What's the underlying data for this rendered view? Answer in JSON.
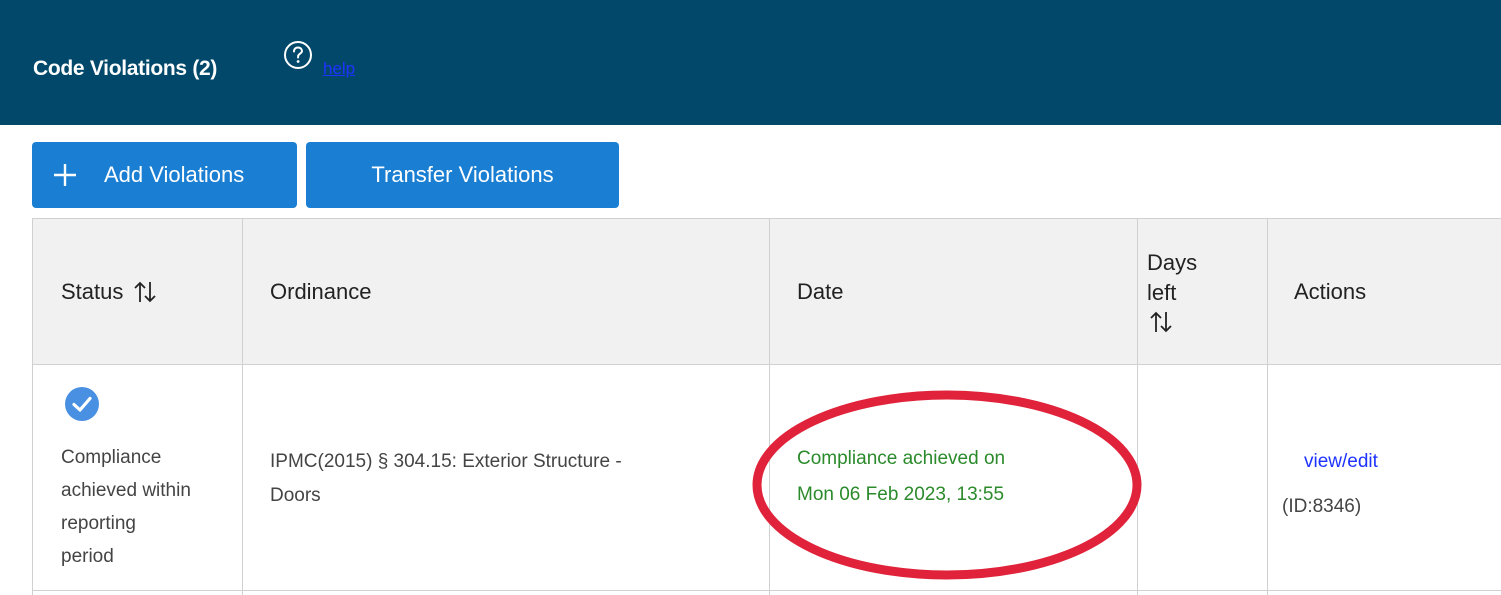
{
  "header": {
    "title": "Code Violations (2)",
    "help_link": "help",
    "background_color": "#02486a"
  },
  "toolbar": {
    "add_label": "Add Violations",
    "transfer_label": "Transfer Violations",
    "button_color": "#1a7fd3"
  },
  "table": {
    "columns": {
      "status": "Status",
      "ordinance": "Ordinance",
      "date": "Date",
      "days_left_line1": "Days",
      "days_left_line2": "left",
      "actions": "Actions"
    },
    "rows": [
      {
        "status_line1": "Compliance",
        "status_line2": "achieved within",
        "status_line3": "reporting",
        "status_line4": "period",
        "ordinance_line1": "IPMC(2015) § 304.15: Exterior Structure -",
        "ordinance_line2": "Doors",
        "date_line1": "Compliance achieved on",
        "date_line2": "Mon 06 Feb 2023, 13:55",
        "days_left": "",
        "action_link": "view/edit",
        "record_id": "(ID:8346)"
      }
    ]
  },
  "colors": {
    "compliance_text": "#2b8a2b",
    "link": "#1f33ff",
    "check_icon": "#4a90e2",
    "annotation": "#e0233a"
  },
  "icons": {
    "help": "question-circle-icon",
    "add": "plus-icon",
    "sort": "sort-arrows-icon",
    "status": "check-circle-icon"
  }
}
